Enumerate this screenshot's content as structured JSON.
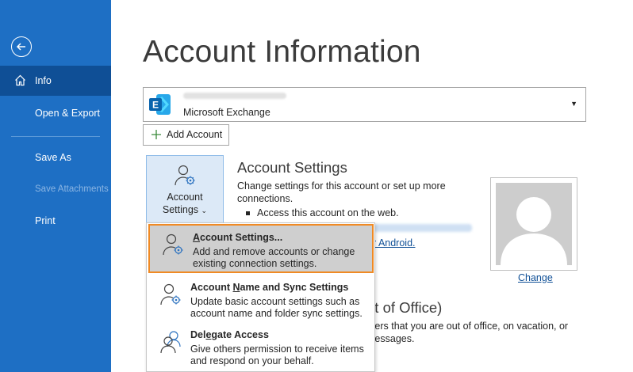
{
  "sidebar": {
    "items": [
      {
        "label": "Info"
      },
      {
        "label": "Open & Export"
      },
      {
        "label": "Save As"
      },
      {
        "label": "Save Attachments"
      },
      {
        "label": "Print"
      }
    ]
  },
  "main": {
    "title": "Account Information",
    "account": {
      "type": "Microsoft Exchange"
    },
    "add_account_label": "Add Account",
    "account_settings_button": {
      "line1": "Account",
      "line2": "Settings"
    },
    "account_settings": {
      "title": "Account Settings",
      "description": "Change settings for this account or set up more connections.",
      "bullet": "Access this account on the web.",
      "link_suffix": "r Android."
    },
    "photo": {
      "change_label": "Change"
    },
    "out_of_office": {
      "title": "ut of Office)",
      "line1": "thers that you are out of office, on vacation, or",
      "line2": "messages."
    }
  },
  "menu": {
    "items": [
      {
        "title_pre": "",
        "title_accel": "A",
        "title_post": "ccount Settings...",
        "description": "Add and remove accounts or change existing connection settings."
      },
      {
        "title_pre": "Account ",
        "title_accel": "N",
        "title_post": "ame and Sync Settings",
        "description": "Update basic account settings such as account name and folder sync settings."
      },
      {
        "title_pre": "Del",
        "title_accel": "e",
        "title_post": "gate Access",
        "description": "Give others permission to receive items and respond on your behalf."
      }
    ]
  },
  "colors": {
    "sidebar_bg": "#1e6fc4",
    "sidebar_active": "#0f4f96",
    "highlight_border": "#f08a24",
    "link": "#0f4f96"
  }
}
